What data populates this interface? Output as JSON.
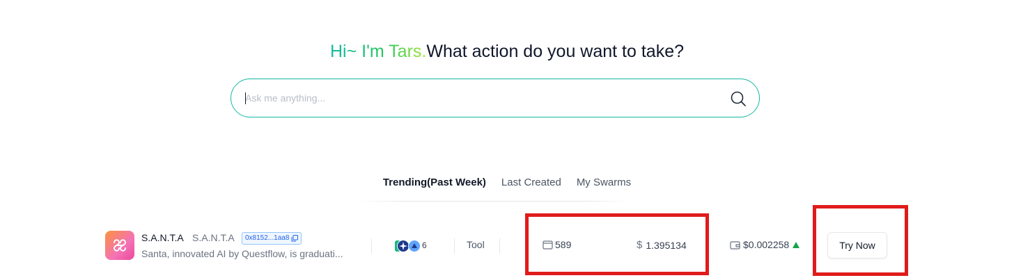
{
  "header": {
    "greeting": "Hi~ I'm Tars.",
    "question": "What action do you want to take?"
  },
  "search": {
    "placeholder": "Ask me anything...",
    "value": "",
    "icon": "search-icon"
  },
  "tabs": [
    {
      "label": "Trending(Past Week)",
      "active": true
    },
    {
      "label": "Last Created",
      "active": false
    },
    {
      "label": "My Swarms",
      "active": false
    }
  ],
  "rows": [
    {
      "name": "S.A.N.T.A",
      "symbol": "S.A.N.T.A",
      "address": "0x8152...1aa8",
      "description": "Santa, innovated AI by Questflow, is graduati...",
      "chain_count": "6",
      "chain_icons": [
        "green-chain-icon",
        "star-chain-icon",
        "boat-chain-icon"
      ],
      "type": "Tool",
      "holders": "589",
      "price": "1.395134",
      "wallet_value": "$0.002258",
      "trend": "up",
      "action_label": "Try Now"
    }
  ],
  "colors": {
    "accent_teal": "#14b8a6",
    "gradient_green": "#22c55e",
    "gradient_lime": "#a3e635",
    "highlight_red": "#e01b1b",
    "trend_up": "#16a34a",
    "address_blue": "#2563eb"
  }
}
